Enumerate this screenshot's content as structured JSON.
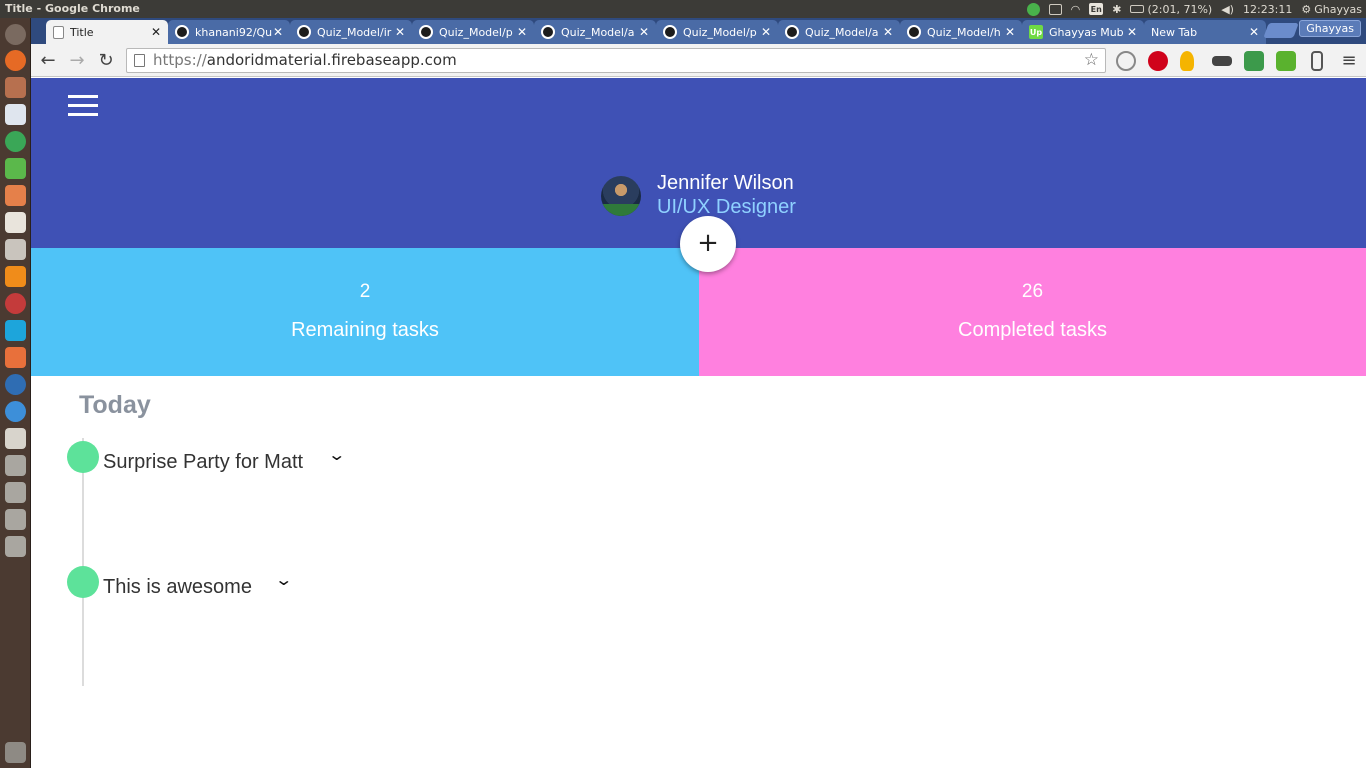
{
  "os": {
    "window_title": "Title - Google Chrome",
    "battery_text": "(2:01, 71%)",
    "keyboard": "En",
    "clock": "12:23:11",
    "user": "Ghayyas"
  },
  "browser": {
    "tabs": [
      {
        "label": "Title",
        "icon": "page-icon",
        "active": true
      },
      {
        "label": "khanani92/Qu",
        "icon": "github-icon"
      },
      {
        "label": "Quiz_Model/ir",
        "icon": "github-icon"
      },
      {
        "label": "Quiz_Model/p",
        "icon": "github-icon"
      },
      {
        "label": "Quiz_Model/a",
        "icon": "github-icon"
      },
      {
        "label": "Quiz_Model/p",
        "icon": "github-icon"
      },
      {
        "label": "Quiz_Model/a",
        "icon": "github-icon"
      },
      {
        "label": "Quiz_Model/h",
        "icon": "github-icon"
      },
      {
        "label": "Ghayyas Mub",
        "icon": "upwork-icon"
      },
      {
        "label": "New Tab",
        "icon": "none"
      }
    ],
    "tab_close": "✕",
    "profile_label": "Ghayyas",
    "url_scheme": "https://",
    "url_host": "andoridmaterial.firebaseapp.com"
  },
  "app": {
    "user_name": "Jennifer Wilson",
    "user_role": "UI/UX Designer",
    "fab_label": "+",
    "stats": {
      "remaining_count": "2",
      "remaining_label": "Remaining tasks",
      "completed_count": "26",
      "completed_label": "Completed tasks"
    },
    "section_title": "Today",
    "tasks": [
      {
        "title": "Surprise Party for Matt"
      },
      {
        "title": "This is awesome"
      }
    ],
    "colors": {
      "header": "#3f51b5",
      "remaining": "#4fc3f7",
      "completed": "#ff80df",
      "task_dot": "#5de29a"
    }
  }
}
